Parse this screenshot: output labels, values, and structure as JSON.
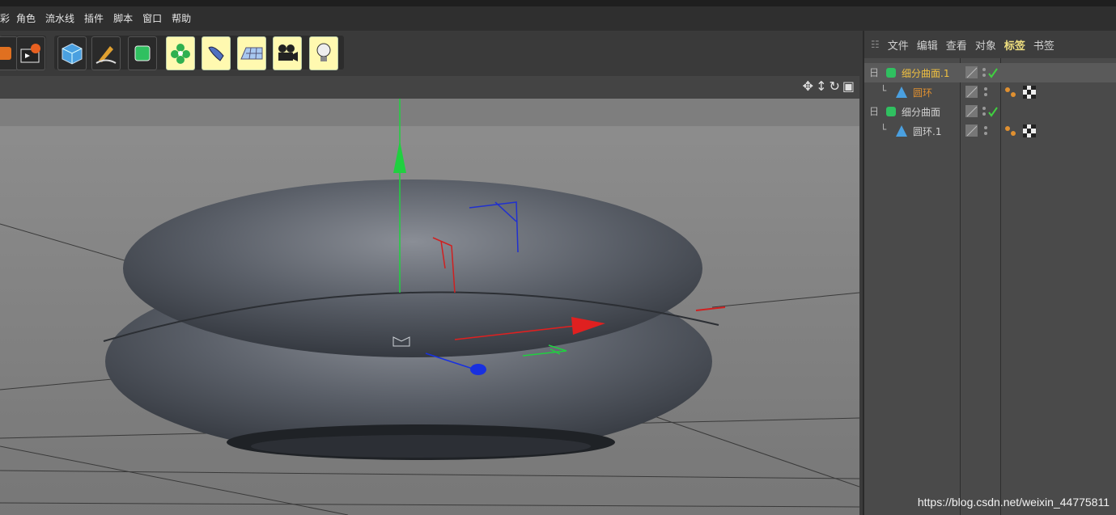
{
  "menubar": {
    "items": [
      {
        "label": "彩"
      },
      {
        "label": "角色"
      },
      {
        "label": "流水线"
      },
      {
        "label": "插件"
      },
      {
        "label": "脚本"
      },
      {
        "label": "窗口"
      },
      {
        "label": "帮助"
      }
    ]
  },
  "toolbar": {
    "tools": [
      {
        "icon": "render-settings-icon"
      },
      {
        "icon": "clapper-icon"
      },
      {
        "icon": "cube-icon"
      },
      {
        "icon": "pen-spline-icon"
      },
      {
        "icon": "subdivision-cube-icon"
      },
      {
        "icon": "cloner-flower-icon"
      },
      {
        "icon": "deformer-icon"
      },
      {
        "icon": "floor-grid-icon"
      },
      {
        "icon": "camera-icon"
      },
      {
        "icon": "light-bulb-icon"
      }
    ]
  },
  "object_manager": {
    "menu": [
      {
        "label": "文件"
      },
      {
        "label": "编辑"
      },
      {
        "label": "查看"
      },
      {
        "label": "对象"
      },
      {
        "label": "标签",
        "active": true
      },
      {
        "label": "书签"
      }
    ],
    "rows": [
      {
        "name": "细分曲面.1",
        "style": "highlight",
        "tree": "日",
        "tags": false
      },
      {
        "name": "圆环",
        "style": "orange",
        "tree": "└",
        "tags": true
      },
      {
        "name": "细分曲面",
        "style": "normal",
        "tree": "日",
        "tags": false
      },
      {
        "name": "圆环.1",
        "style": "normal",
        "tree": "└",
        "tags": true
      }
    ]
  },
  "watermark": "https://blog.csdn.net/weixin_44775811"
}
